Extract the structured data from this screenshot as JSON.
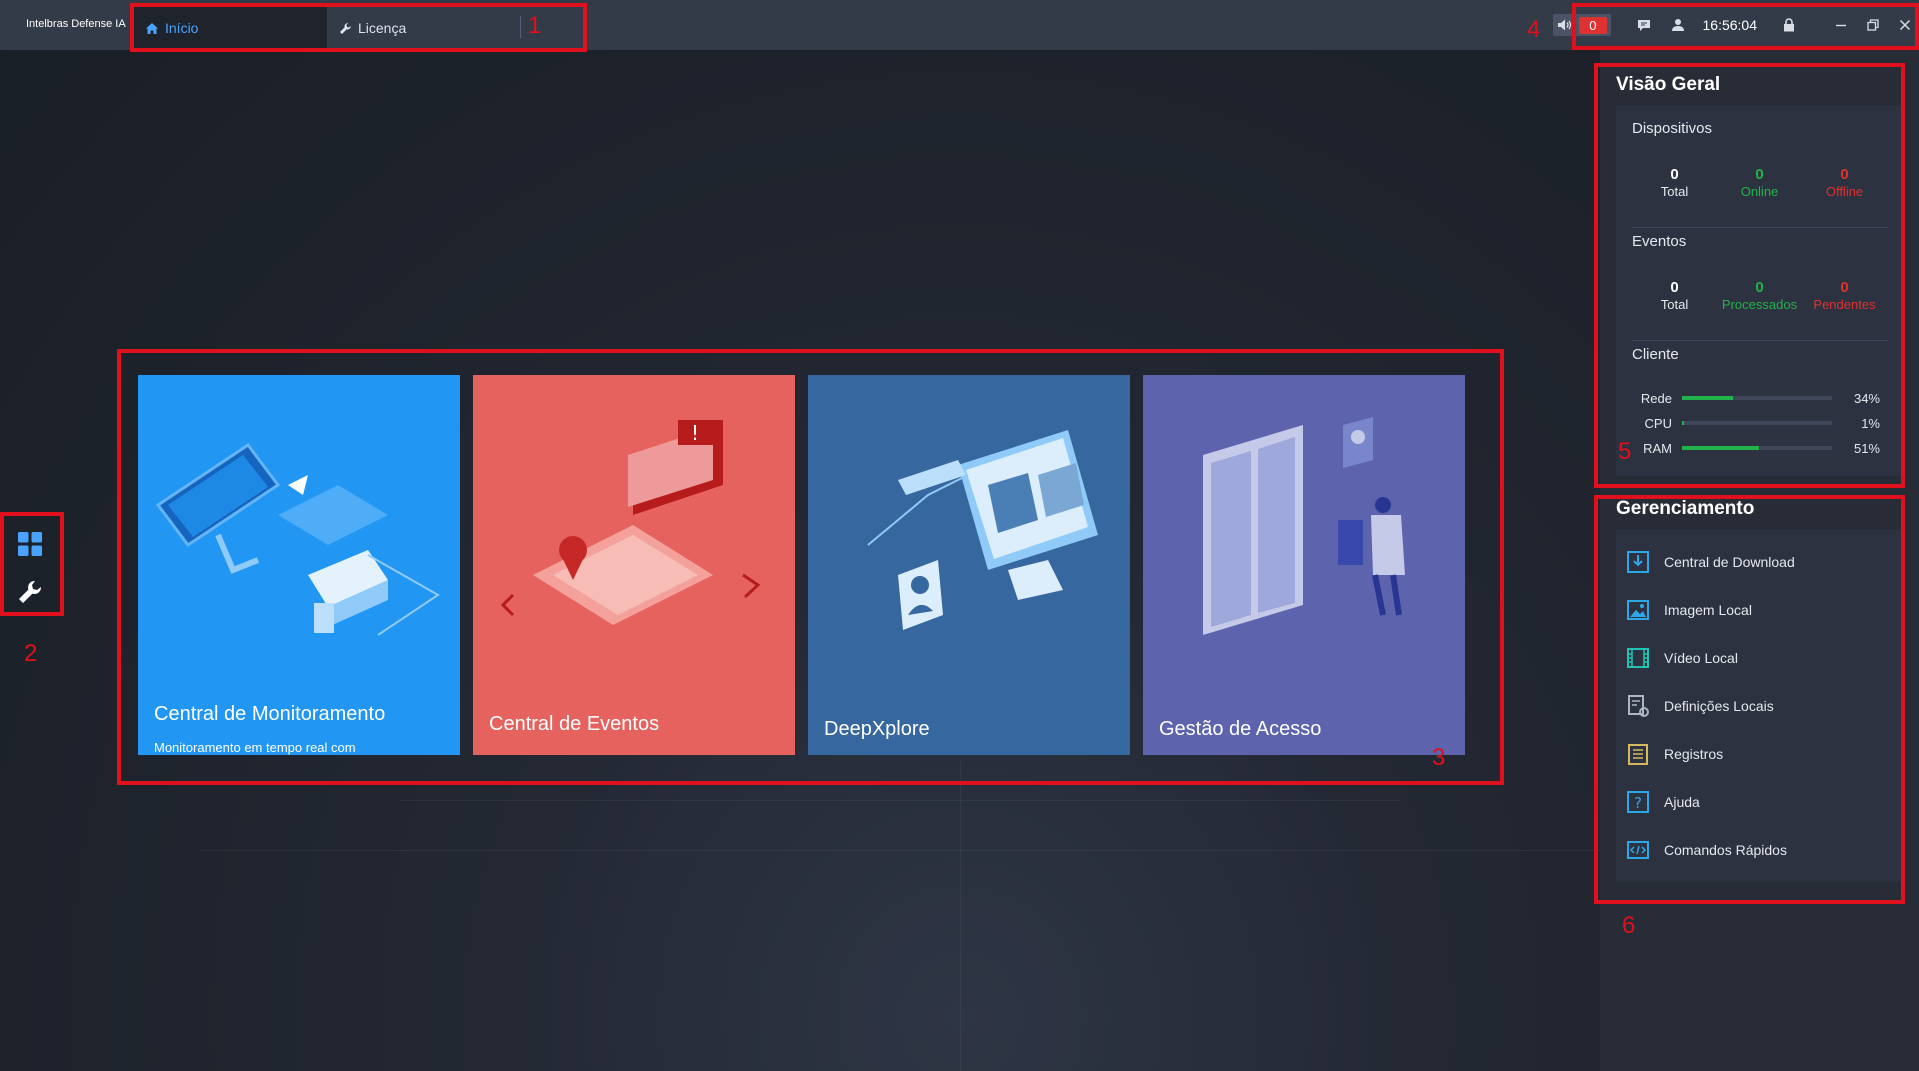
{
  "app": {
    "title": "Intelbras Defense IA"
  },
  "tabs": [
    {
      "label": "Início",
      "icon": "home-icon"
    },
    {
      "label": "Licença",
      "icon": "wrench-icon"
    }
  ],
  "topbar": {
    "alarm_count": "0",
    "time": "16:56:04"
  },
  "cards": [
    {
      "title": "Central de Monitoramento",
      "desc": "Monitoramento em tempo real com",
      "color": "#2196f3"
    },
    {
      "title": "Central de Eventos",
      "desc": "",
      "color": "#e5625f"
    },
    {
      "title": "DeepXplore",
      "desc": "",
      "color": "#36679e"
    },
    {
      "title": "Gestão de Acesso",
      "desc": "",
      "color": "#5e63ae"
    }
  ],
  "overview": {
    "title": "Visão Geral",
    "devices": {
      "label": "Dispositivos",
      "stats": [
        {
          "value": "0",
          "label": "Total"
        },
        {
          "value": "0",
          "label": "Online"
        },
        {
          "value": "0",
          "label": "Offline"
        }
      ]
    },
    "events": {
      "label": "Eventos",
      "stats": [
        {
          "value": "0",
          "label": "Total"
        },
        {
          "value": "0",
          "label": "Processados"
        },
        {
          "value": "0",
          "label": "Pendentes"
        }
      ]
    },
    "client": {
      "label": "Cliente",
      "resources": [
        {
          "name": "Rede",
          "value": "34%",
          "fraction": 0.34
        },
        {
          "name": "CPU",
          "value": "1%",
          "fraction": 0.01
        },
        {
          "name": "RAM",
          "value": "51%",
          "fraction": 0.51
        }
      ]
    }
  },
  "management": {
    "title": "Gerenciamento",
    "items": [
      {
        "label": "Central de Download",
        "icon": "download-icon"
      },
      {
        "label": "Imagem Local",
        "icon": "image-icon"
      },
      {
        "label": "Vídeo Local",
        "icon": "video-icon"
      },
      {
        "label": "Definições Locais",
        "icon": "settings-doc-icon"
      },
      {
        "label": "Registros",
        "icon": "log-icon"
      },
      {
        "label": "Ajuda",
        "icon": "help-icon"
      },
      {
        "label": "Comandos Rápidos",
        "icon": "shortcut-icon"
      }
    ]
  },
  "annotations": [
    "1",
    "2",
    "3",
    "4",
    "5",
    "6"
  ],
  "colors": {
    "green": "#21b24a",
    "red": "#e03131",
    "accent": "#4aa3ff",
    "annotation": "#e0101c"
  }
}
